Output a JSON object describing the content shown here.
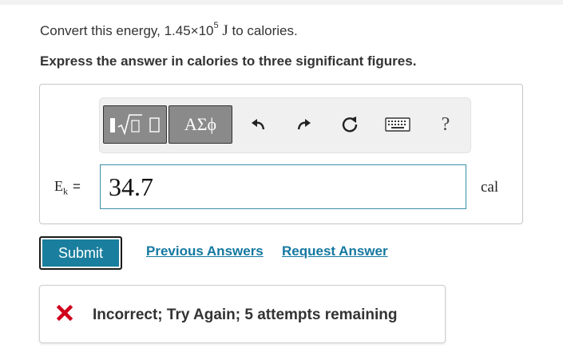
{
  "question": {
    "prefix": "Convert this energy, 1.45×10",
    "exponent": "5",
    "unit_symbol": "J",
    "suffix": "to calories."
  },
  "instruction": "Express the answer in calories to three significant figures.",
  "toolbar": {
    "templates_icon": "sqrt-template-icon",
    "greek_label": "ΑΣϕ",
    "undo_icon": "undo-icon",
    "redo_icon": "redo-icon",
    "reset_icon": "reset-icon",
    "keyboard_icon": "keyboard-icon",
    "help_label": "?"
  },
  "answer": {
    "label_main": "E",
    "label_sub": "k",
    "equals": "=",
    "value": "34.7",
    "unit": "cal"
  },
  "actions": {
    "submit_label": "Submit",
    "previous_answers_label": "Previous Answers",
    "request_answer_label": "Request Answer"
  },
  "feedback": {
    "message": "Incorrect; Try Again; 5 attempts remaining",
    "icon": "x-icon",
    "icon_color": "#d0021b"
  },
  "colors": {
    "accent": "#1a7f9e",
    "link": "#1478a0",
    "error": "#d0021b"
  }
}
